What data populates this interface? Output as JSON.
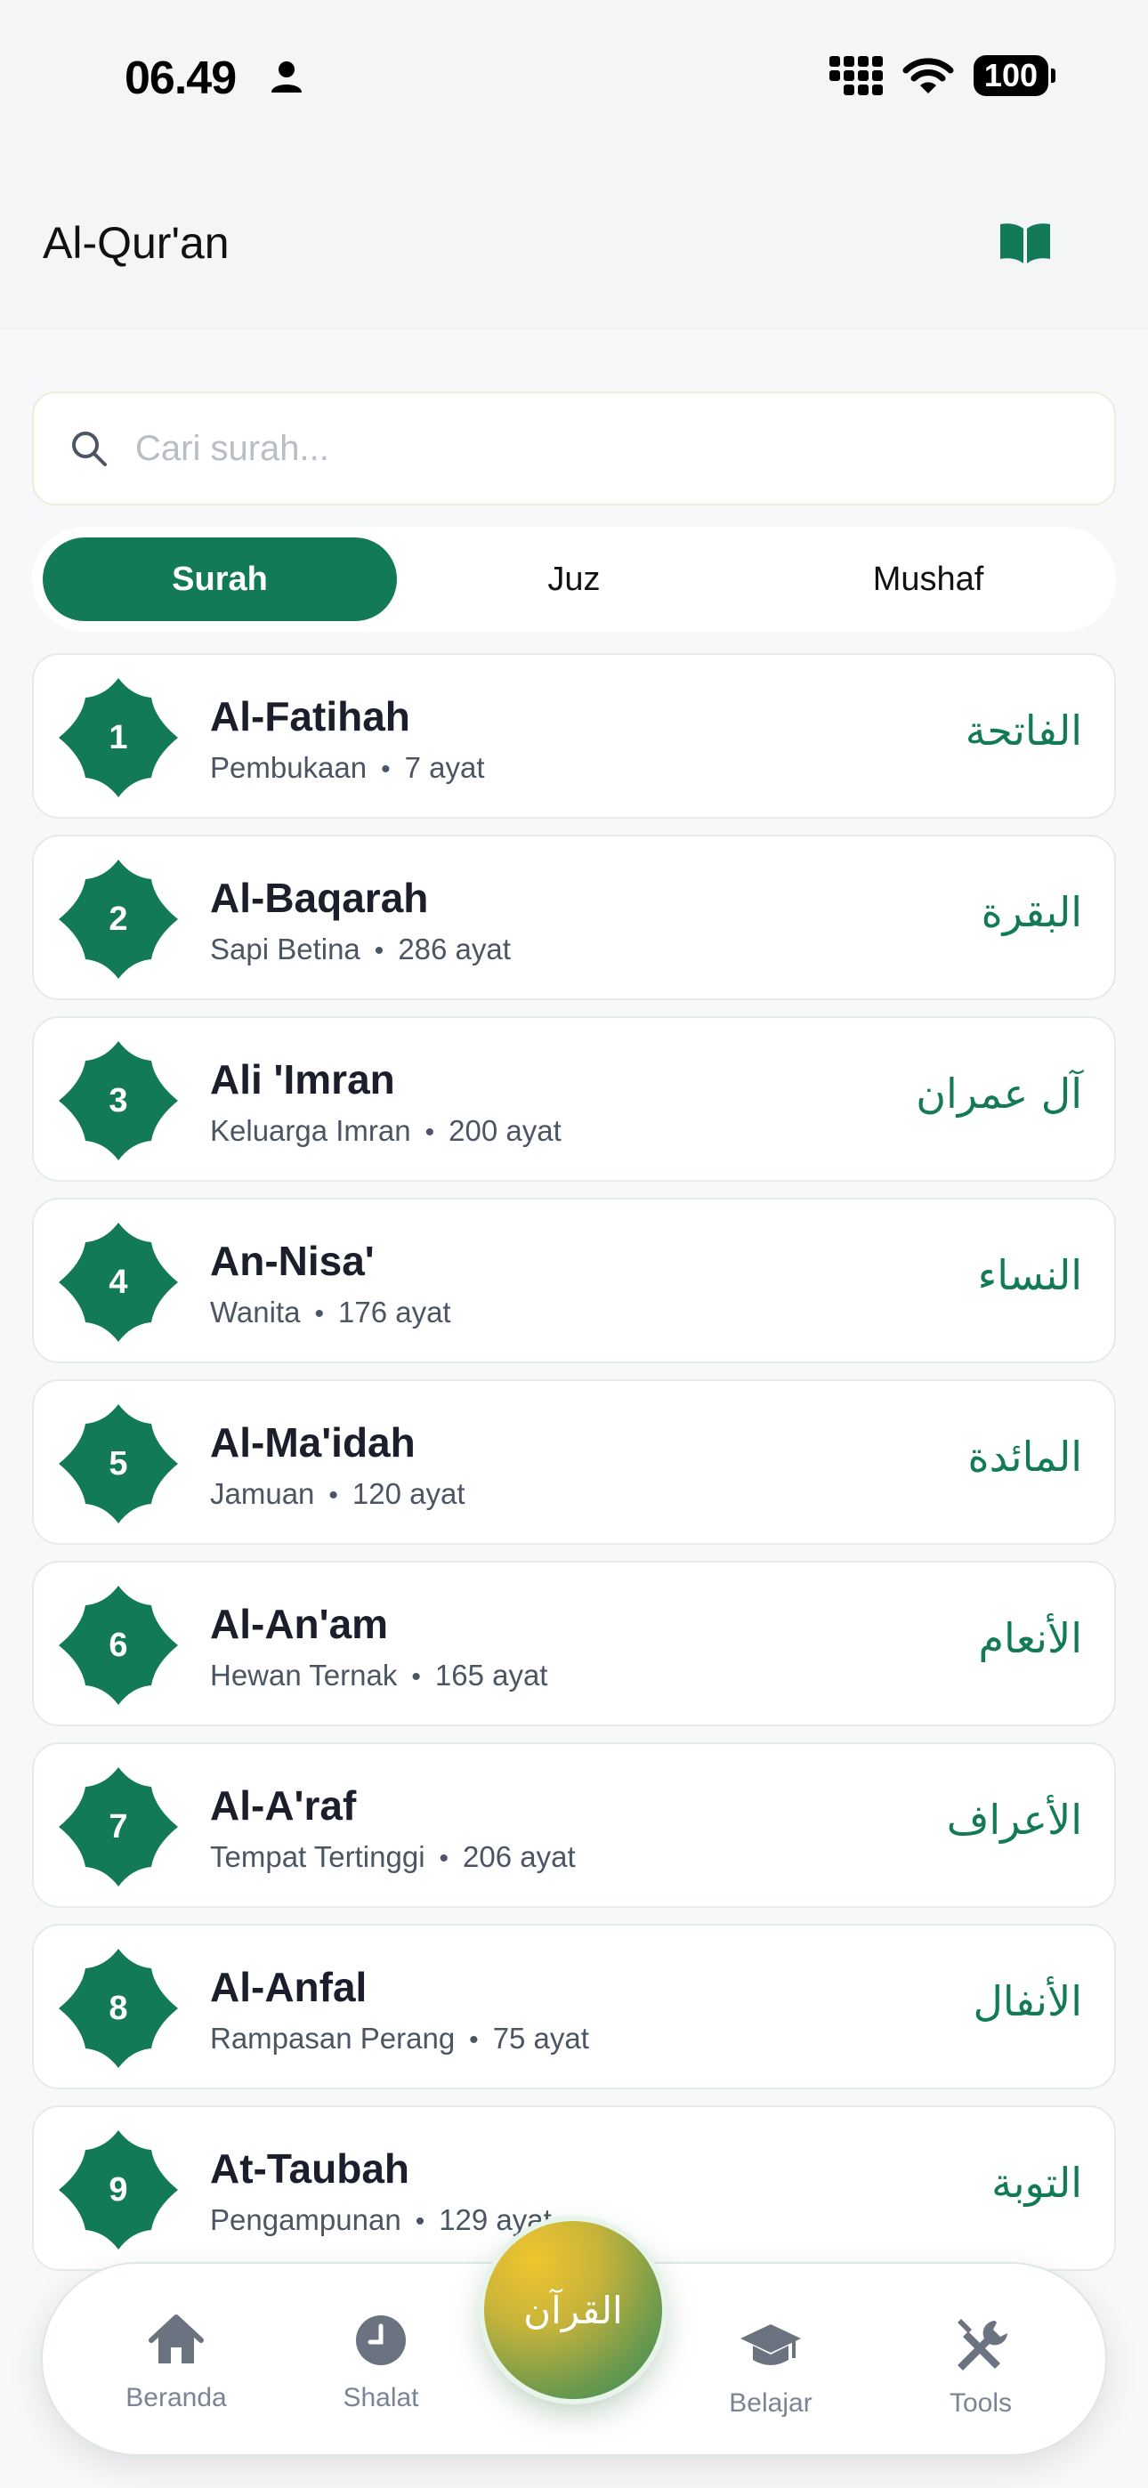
{
  "status_bar": {
    "time": "06.49",
    "battery": "100"
  },
  "header": {
    "title": "Al-Qur'an"
  },
  "search": {
    "placeholder": "Cari surah..."
  },
  "tabs": [
    {
      "label": "Surah",
      "active": true
    },
    {
      "label": "Juz",
      "active": false
    },
    {
      "label": "Mushaf",
      "active": false
    }
  ],
  "surahs": [
    {
      "number": "1",
      "name": "Al-Fatihah",
      "meaning": "Pembukaan",
      "ayat": "7 ayat",
      "arabic": "الفاتحة"
    },
    {
      "number": "2",
      "name": "Al-Baqarah",
      "meaning": "Sapi Betina",
      "ayat": "286 ayat",
      "arabic": "البقرة"
    },
    {
      "number": "3",
      "name": "Ali 'Imran",
      "meaning": "Keluarga Imran",
      "ayat": "200 ayat",
      "arabic": "آل عمران"
    },
    {
      "number": "4",
      "name": "An-Nisa'",
      "meaning": "Wanita",
      "ayat": "176 ayat",
      "arabic": "النساء"
    },
    {
      "number": "5",
      "name": "Al-Ma'idah",
      "meaning": "Jamuan",
      "ayat": "120 ayat",
      "arabic": "المائدة"
    },
    {
      "number": "6",
      "name": "Al-An'am",
      "meaning": "Hewan Ternak",
      "ayat": "165 ayat",
      "arabic": "الأنعام"
    },
    {
      "number": "7",
      "name": "Al-A'raf",
      "meaning": "Tempat Tertinggi",
      "ayat": "206 ayat",
      "arabic": "الأعراف"
    },
    {
      "number": "8",
      "name": "Al-Anfal",
      "meaning": "Rampasan Perang",
      "ayat": "75 ayat",
      "arabic": "الأنفال"
    },
    {
      "number": "9",
      "name": "At-Taubah",
      "meaning": "Pengampunan",
      "ayat": "129 ayat",
      "arabic": "التوبة"
    }
  ],
  "nav": {
    "home_label": "Beranda",
    "prayer_label": "Shalat",
    "quran_label": "القرآن",
    "learn_label": "Belajar",
    "tools_label": "Tools"
  },
  "colors": {
    "primary": "#137a57",
    "background": "#f6f8fa",
    "muted_text": "#7b8494"
  }
}
